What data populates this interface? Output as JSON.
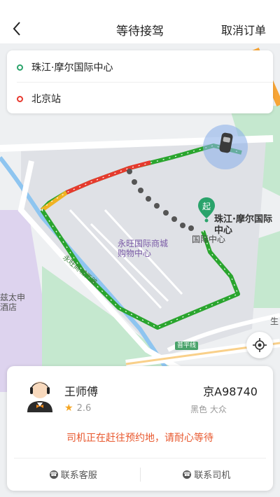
{
  "header": {
    "title": "等待接驾",
    "cancel_label": "取消订单"
  },
  "trip": {
    "start": "珠江·摩尔国际中心",
    "end": "北京站"
  },
  "map": {
    "poi_label": "珠江·摩尔国际中心",
    "poi_sub": "国际中心",
    "start_marker": "起",
    "mall_label": "永旺国际商城购物中心",
    "road_label": "永旺商城西路",
    "hotel_label_1": "兹太申",
    "hotel_label_2": "酒店",
    "road_badge": "普平线",
    "partial_label": "生"
  },
  "driver": {
    "name": "王师傅",
    "rating": "2.6",
    "plate": "京A98740",
    "car": "黑色 大众",
    "status": "司机正在赶往预约地，请耐心等待"
  },
  "actions": {
    "service": "联系客服",
    "driver": "联系司机"
  },
  "colors": {
    "route_green": "#2aa52e",
    "route_red": "#e63b2e",
    "route_yellow": "#f0b323",
    "status_orange": "#e8582e"
  }
}
